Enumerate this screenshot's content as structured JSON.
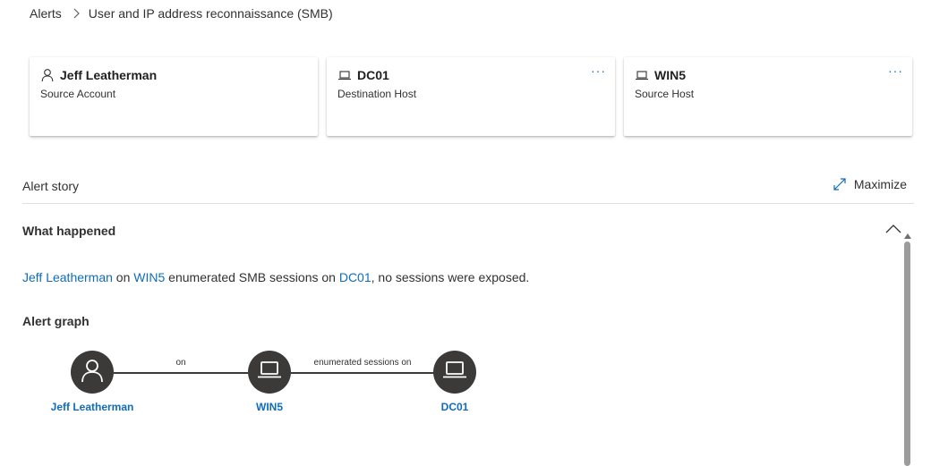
{
  "breadcrumb": {
    "root": "Alerts",
    "current": "User and IP address reconnaissance (SMB)"
  },
  "cards": [
    {
      "title": "Jeff Leatherman",
      "subtitle": "Source Account",
      "icon": "user-icon",
      "has_more": false
    },
    {
      "title": "DC01",
      "subtitle": "Destination Host",
      "icon": "laptop-icon",
      "has_more": true,
      "more": "···"
    },
    {
      "title": "WIN5",
      "subtitle": "Source Host",
      "icon": "laptop-icon",
      "has_more": true,
      "more": "···"
    }
  ],
  "story": {
    "title": "Alert story",
    "maximize_label": "Maximize"
  },
  "what_happened": {
    "title": "What happened",
    "sentence": {
      "user": "Jeff Leatherman",
      "t1": " on ",
      "source": "WIN5",
      "t2": " enumerated SMB sessions on ",
      "dest": "DC01",
      "t3": ", no sessions were exposed."
    }
  },
  "graph": {
    "title": "Alert graph",
    "nodes": [
      {
        "label": "Jeff Leatherman",
        "icon": "user-icon"
      },
      {
        "label": "WIN5",
        "icon": "laptop-icon"
      },
      {
        "label": "DC01",
        "icon": "laptop-icon"
      }
    ],
    "edges": [
      {
        "label": "on"
      },
      {
        "label": "enumerated sessions on"
      }
    ]
  },
  "colors": {
    "link": "#0f6cbd",
    "node_fill": "#3b3a39",
    "text": "#323130"
  }
}
